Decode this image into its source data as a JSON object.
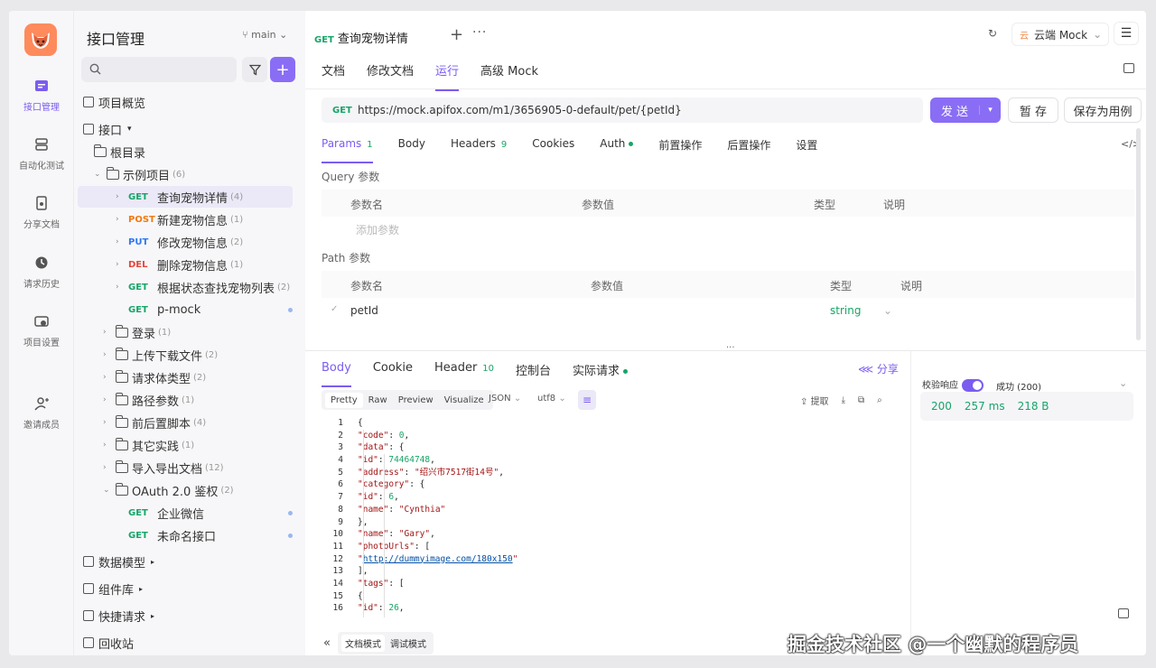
{
  "rail": {
    "items": [
      {
        "label": "接口管理",
        "icon": "api-icon"
      },
      {
        "label": "自动化测试",
        "icon": "auto-test-icon"
      },
      {
        "label": "分享文档",
        "icon": "share-doc-icon"
      },
      {
        "label": "请求历史",
        "icon": "history-icon"
      },
      {
        "label": "项目设置",
        "icon": "settings-icon"
      },
      {
        "label": "邀请成员",
        "icon": "invite-icon"
      }
    ]
  },
  "sidebar": {
    "title": "接口管理",
    "branch": "main",
    "overview": "项目概览",
    "api_section": "接口",
    "root": "根目录",
    "example": {
      "name": "示例项目",
      "count": "(6)"
    },
    "endpoints": [
      {
        "method": "GET",
        "name": "查询宠物详情",
        "count": "(4)"
      },
      {
        "method": "POST",
        "name": "新建宠物信息",
        "count": "(1)"
      },
      {
        "method": "PUT",
        "name": "修改宠物信息",
        "count": "(2)"
      },
      {
        "method": "DEL",
        "name": "删除宠物信息",
        "count": "(1)"
      },
      {
        "method": "GET",
        "name": "根据状态查找宠物列表",
        "count": "(2)"
      },
      {
        "method": "GET",
        "name": "p-mock",
        "count": ""
      }
    ],
    "folders": [
      {
        "name": "登录",
        "count": "(1)"
      },
      {
        "name": "上传下载文件",
        "count": "(2)"
      },
      {
        "name": "请求体类型",
        "count": "(2)"
      },
      {
        "name": "路径参数",
        "count": "(1)"
      },
      {
        "name": "前后置脚本",
        "count": "(4)"
      },
      {
        "name": "其它实践",
        "count": "(1)"
      },
      {
        "name": "导入导出文档",
        "count": "(12)"
      }
    ],
    "oauth": {
      "name": "OAuth 2.0 鉴权",
      "count": "(2)"
    },
    "oauth_items": [
      {
        "method": "GET",
        "name": "企业微信"
      },
      {
        "method": "GET",
        "name": "未命名接口"
      }
    ],
    "bottom": [
      "数据模型",
      "组件库",
      "快捷请求",
      "回收站"
    ]
  },
  "main": {
    "tab": {
      "method": "GET",
      "name": "查询宠物详情"
    },
    "cloud_mock": "云端 Mock",
    "cloud_badge": "云",
    "subtabs": [
      "文档",
      "修改文档",
      "运行",
      "高级 Mock"
    ],
    "method": "GET",
    "url": "https://mock.apifox.com/m1/3656905-0-default/pet/{petId}",
    "send": "发 送",
    "save_temp": "暂 存",
    "save_case": "保存为用例",
    "param_tabs": [
      {
        "label": "Params",
        "n": "1"
      },
      {
        "label": "Body",
        "n": ""
      },
      {
        "label": "Headers",
        "n": "9"
      },
      {
        "label": "Cookies",
        "n": ""
      },
      {
        "label": "Auth",
        "n": ""
      },
      {
        "label": "前置操作",
        "n": ""
      },
      {
        "label": "后置操作",
        "n": ""
      },
      {
        "label": "设置",
        "n": ""
      }
    ],
    "query_title": "Query 参数",
    "path_title": "Path 参数",
    "cols": {
      "name": "参数名",
      "value": "参数值",
      "type": "类型",
      "desc": "说明"
    },
    "add_param": "添加参数",
    "path_param": {
      "name": "petId",
      "type": "string"
    }
  },
  "response": {
    "tabs": [
      {
        "label": "Body",
        "n": ""
      },
      {
        "label": "Cookie",
        "n": ""
      },
      {
        "label": "Header",
        "n": "10"
      },
      {
        "label": "控制台",
        "n": ""
      },
      {
        "label": "实际请求",
        "n": ""
      }
    ],
    "share": "分享",
    "formats": [
      "Pretty",
      "Raw",
      "Preview",
      "Visualize"
    ],
    "lang": "JSON",
    "encoding": "utf8",
    "extract": "提取",
    "validate_label": "校验响应",
    "result": "成功 (200)",
    "status": "200",
    "time": "257 ms",
    "size": "218 B",
    "modes": [
      "文档模式",
      "调试模式"
    ]
  },
  "watermark": "掘金技术社区 @一个幽默的程序员"
}
